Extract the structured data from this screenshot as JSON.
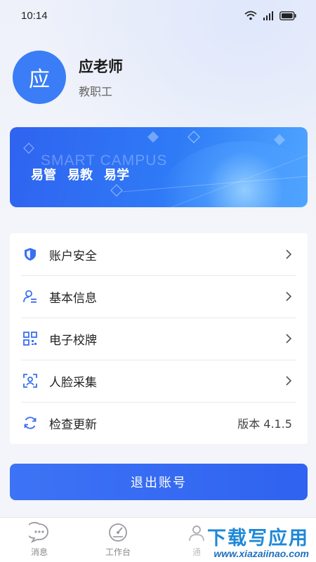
{
  "status_bar": {
    "time": "10:14"
  },
  "profile": {
    "avatar_char": "应",
    "name": "应老师",
    "role": "教职工"
  },
  "banner": {
    "en_text": "SMART CAMPUS",
    "slogans": [
      "易管",
      "易教",
      "易学"
    ]
  },
  "menu": {
    "items": [
      {
        "label": "账户安全",
        "icon": "shield-icon"
      },
      {
        "label": "基本信息",
        "icon": "person-info-icon"
      },
      {
        "label": "电子校牌",
        "icon": "qr-code-icon"
      },
      {
        "label": "人脸采集",
        "icon": "face-scan-icon"
      },
      {
        "label": "检查更新",
        "icon": "refresh-icon",
        "value": "版本 4.1.5"
      }
    ]
  },
  "logout": {
    "label": "退出账号"
  },
  "tabbar": {
    "tabs": [
      {
        "label": "消息",
        "icon": "message-icon"
      },
      {
        "label": "工作台",
        "icon": "dashboard-icon"
      },
      {
        "label": "通",
        "icon": "contacts-icon"
      }
    ]
  },
  "watermark": {
    "cn": "下载写应用",
    "en": "www.xiazaiinao.com"
  },
  "colors": {
    "accent": "#3a7df6",
    "button": "#3468f2",
    "icon": "#3a6ff0"
  }
}
